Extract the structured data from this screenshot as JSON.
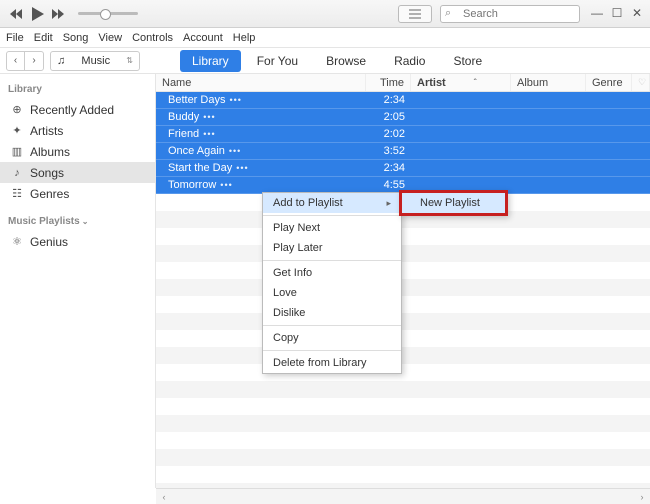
{
  "titlebar": {
    "search_placeholder": "Search"
  },
  "menubar": [
    "File",
    "Edit",
    "Song",
    "View",
    "Controls",
    "Account",
    "Help"
  ],
  "mediadrop": {
    "icon": "♫",
    "label": "Music"
  },
  "tabs": [
    {
      "label": "Library",
      "active": true
    },
    {
      "label": "For You",
      "active": false
    },
    {
      "label": "Browse",
      "active": false
    },
    {
      "label": "Radio",
      "active": false
    },
    {
      "label": "Store",
      "active": false
    }
  ],
  "sidebar": {
    "section1": "Library",
    "items": [
      {
        "icon": "⊕",
        "label": "Recently Added"
      },
      {
        "icon": "✦",
        "label": "Artists"
      },
      {
        "icon": "▥",
        "label": "Albums"
      },
      {
        "icon": "♪",
        "label": "Songs"
      },
      {
        "icon": "☷",
        "label": "Genres"
      }
    ],
    "section2": "Music Playlists",
    "genius": {
      "icon": "⚛",
      "label": "Genius"
    }
  },
  "columns": {
    "name": "Name",
    "time": "Time",
    "artist": "Artist",
    "album": "Album",
    "genre": "Genre"
  },
  "tracks": [
    {
      "name": "Better Days",
      "time": "2:34"
    },
    {
      "name": "Buddy",
      "time": "2:05"
    },
    {
      "name": "Friend",
      "time": "2:02"
    },
    {
      "name": "Once Again",
      "time": "3:52"
    },
    {
      "name": "Start the Day",
      "time": "2:34"
    },
    {
      "name": "Tomorrow",
      "time": "4:55"
    }
  ],
  "context_menu": {
    "add_to_playlist": "Add to Playlist",
    "play_next": "Play Next",
    "play_later": "Play Later",
    "get_info": "Get Info",
    "love": "Love",
    "dislike": "Dislike",
    "copy": "Copy",
    "delete": "Delete from Library"
  },
  "submenu": {
    "new_playlist": "New Playlist"
  }
}
